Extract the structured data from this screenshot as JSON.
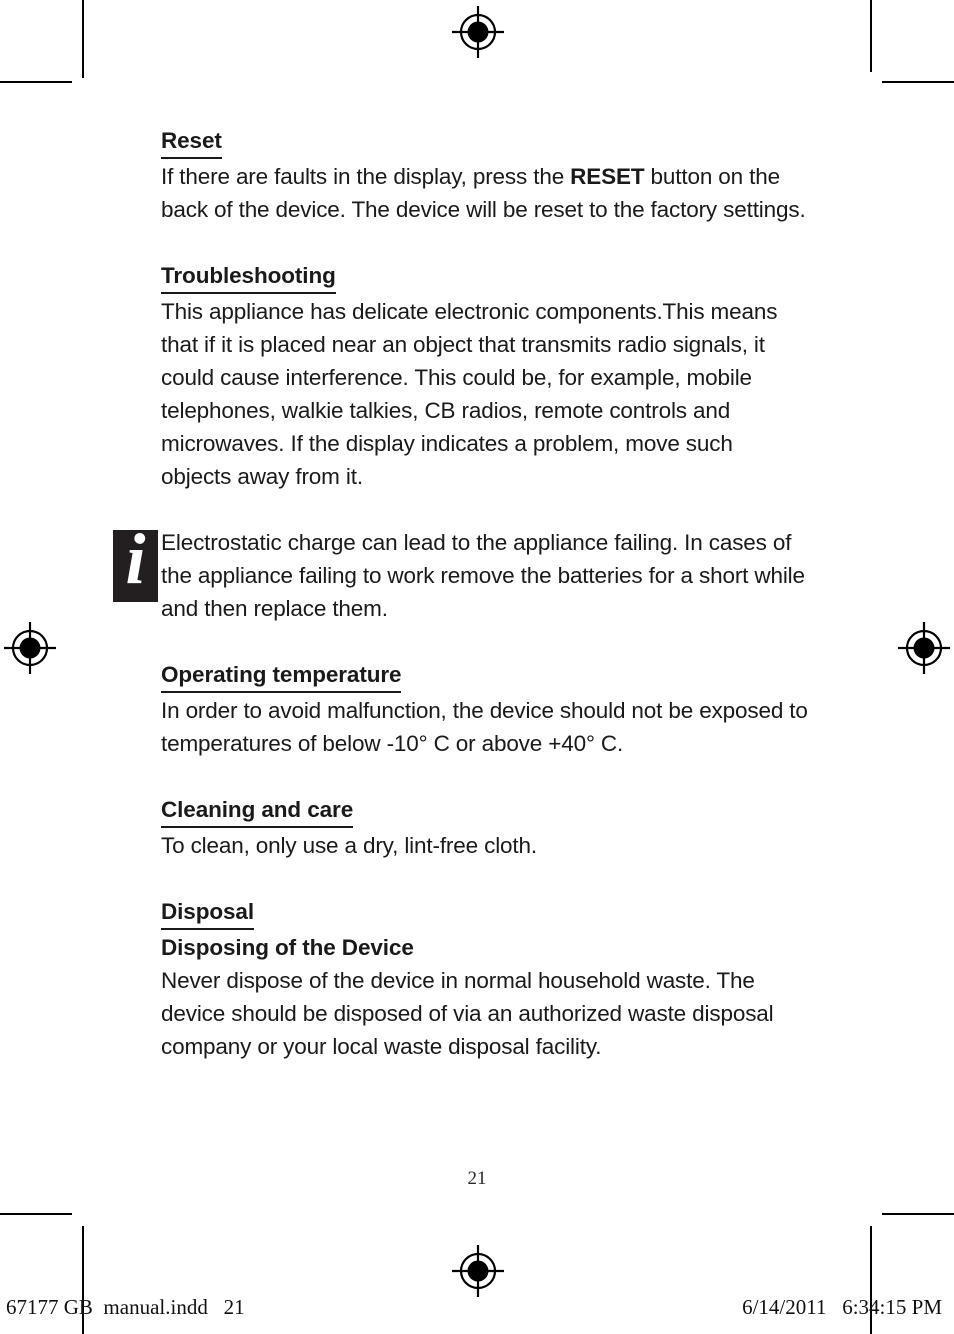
{
  "document": {
    "page_number": "21",
    "sections": [
      {
        "id": "reset",
        "heading": "Reset",
        "body_before_bold": "If there are faults in the display, press the ",
        "body_bold": "RESET",
        "body_after_bold": " button on the back of the device. The device will be reset to the factory settings."
      },
      {
        "id": "troubleshooting",
        "heading": "Troubleshooting",
        "body": "This appliance has delicate electronic components.This means that if it is placed near an object that transmits radio signals, it could cause interference. This could be, for example, mobile telephones, walkie talkies, CB radios, remote controls and microwaves. If the display indicates a problem, move such objects away from it."
      },
      {
        "id": "operating-temperature",
        "heading": "Operating temperature",
        "body": "In order to avoid malfunction, the device should not be exposed to temperatures of below -10° C or above +40° C."
      },
      {
        "id": "cleaning-and-care",
        "heading": "Cleaning and care",
        "body": "To clean, only use a dry, lint-free cloth."
      },
      {
        "id": "disposal",
        "heading": "Disposal",
        "subheading": "Disposing of the Device",
        "body": "Never dispose of the device in normal household waste. The device should be disposed of via an authorized waste disposal company or your local waste disposal facility."
      }
    ],
    "note": {
      "icon_glyph": "i",
      "text": "Electrostatic charge can lead to the appliance failing. In cases of the appliance failing to work remove the batteries for a short while and then replace them."
    }
  },
  "footer": {
    "left": "67177 GB  manual.indd   21",
    "right": "6/14/2011   6:34:15 PM"
  },
  "colors": {
    "text": "#1a1a1a",
    "icon_background": "#231f20",
    "marks": "#000000",
    "page_background": "#ffffff"
  }
}
